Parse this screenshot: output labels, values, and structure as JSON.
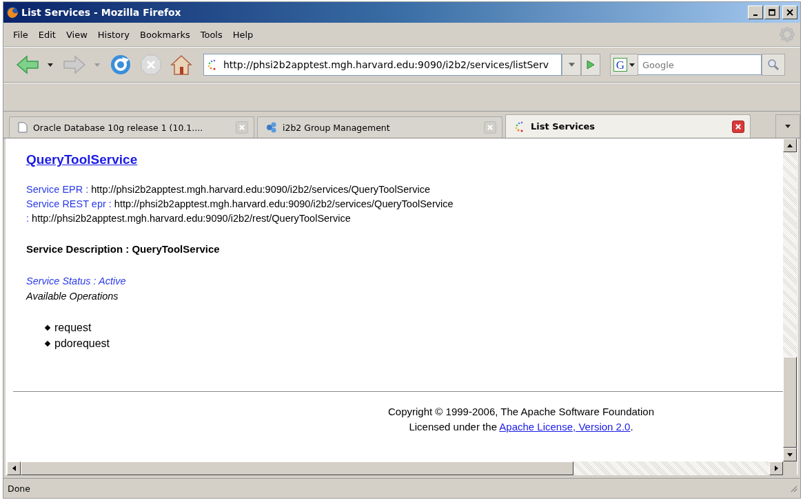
{
  "window": {
    "title": "List Services - Mozilla Firefox"
  },
  "menu": [
    "File",
    "Edit",
    "View",
    "History",
    "Bookmarks",
    "Tools",
    "Help"
  ],
  "toolbar": {
    "url": "http://phsi2b2apptest.mgh.harvard.edu:9090/i2b2/services/listServ",
    "search_placeholder": "Google",
    "engine_letter": "G"
  },
  "tabs": [
    {
      "label": "Oracle Database 10g release 1 (10.1....",
      "selected": false,
      "kind": "document"
    },
    {
      "label": "i2b2 Group Management",
      "selected": false,
      "kind": "group"
    },
    {
      "label": "List Services",
      "selected": true,
      "kind": "loading"
    }
  ],
  "page": {
    "heading": "QueryToolService",
    "epr_lines": [
      {
        "label": "Service EPR : ",
        "value": "http://phsi2b2apptest.mgh.harvard.edu:9090/i2b2/services/QueryToolService"
      },
      {
        "label": "Service REST epr : ",
        "value": "http://phsi2b2apptest.mgh.harvard.edu:9090/i2b2/services/QueryToolService"
      },
      {
        "label": ": ",
        "value": "http://phsi2b2apptest.mgh.harvard.edu:9090/i2b2/rest/QueryToolService"
      }
    ],
    "description": "Service Description : QueryToolService",
    "status": "Service Status : Active",
    "operations_label": "Available Operations",
    "operations": [
      "request",
      "pdorequest"
    ],
    "copyright": "Copyright © 1999-2006, The Apache Software Foundation",
    "license": {
      "prefix": "Licensed under the ",
      "link": "Apache License, Version 2.0",
      "suffix": "."
    }
  },
  "status_bar": "Done"
}
